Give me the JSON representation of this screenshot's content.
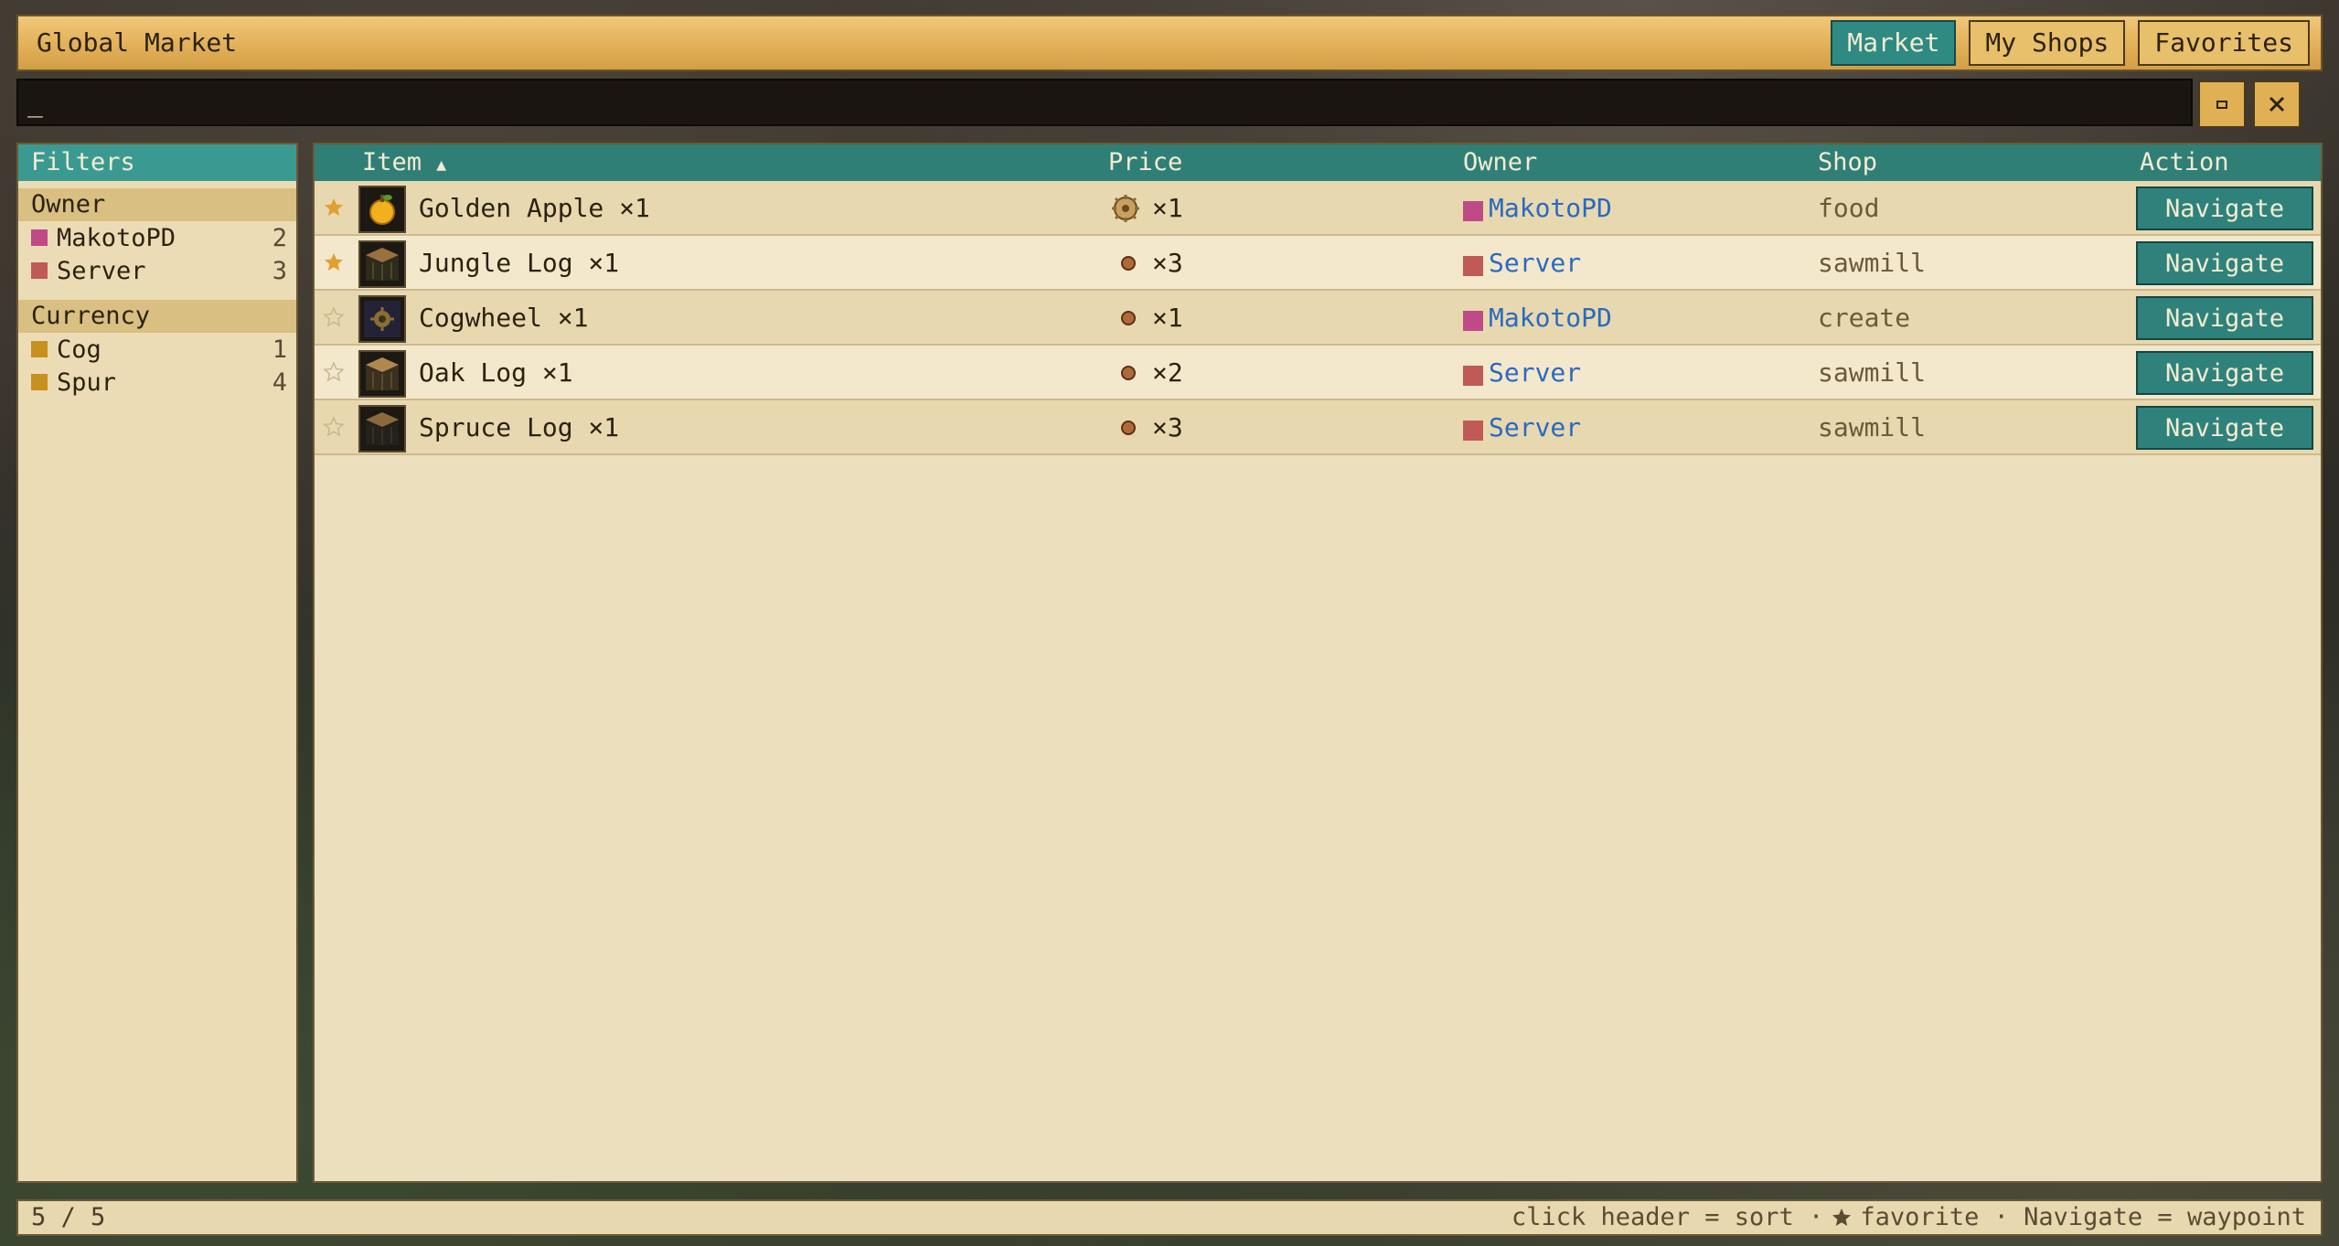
{
  "window": {
    "title": "Global Market"
  },
  "tabs": [
    {
      "label": "Market",
      "active": true
    },
    {
      "label": "My Shops",
      "active": false
    },
    {
      "label": "Favorites",
      "active": false
    }
  ],
  "search": {
    "value": "_",
    "refresh_icon": "refresh-icon",
    "close_icon": "close-icon"
  },
  "filters": {
    "title": "Filters",
    "groups": [
      {
        "label": "Owner",
        "items": [
          {
            "label": "MakotoPD",
            "count": "2",
            "color": "#c04a86"
          },
          {
            "label": "Server",
            "count": "3",
            "color": "#c05a56"
          }
        ]
      },
      {
        "label": "Currency",
        "items": [
          {
            "label": "Cog",
            "count": "1",
            "color": "#c8901e"
          },
          {
            "label": "Spur",
            "count": "4",
            "color": "#c8901e"
          }
        ]
      }
    ]
  },
  "table": {
    "headers": {
      "item": "Item",
      "sort_indicator": "▲",
      "price": "Price",
      "owner": "Owner",
      "shop": "Shop",
      "action": "Action"
    },
    "rows": [
      {
        "favorite": true,
        "icon": "golden-apple-icon",
        "item": "Golden Apple ×1",
        "price_icon": "cog-coin-icon",
        "price": "×1",
        "owner": "MakotoPD",
        "owner_color": "#c04a86",
        "shop": "food",
        "action": "Navigate"
      },
      {
        "favorite": true,
        "icon": "jungle-log-icon",
        "item": "Jungle Log ×1",
        "price_icon": "spur-coin-icon",
        "price": "×3",
        "owner": "Server",
        "owner_color": "#c05a56",
        "shop": "sawmill",
        "action": "Navigate"
      },
      {
        "favorite": false,
        "icon": "cogwheel-icon",
        "item": "Cogwheel ×1",
        "price_icon": "spur-coin-icon",
        "price": "×1",
        "owner": "MakotoPD",
        "owner_color": "#c04a86",
        "shop": "create",
        "action": "Navigate"
      },
      {
        "favorite": false,
        "icon": "oak-log-icon",
        "item": "Oak Log ×1",
        "price_icon": "spur-coin-icon",
        "price": "×2",
        "owner": "Server",
        "owner_color": "#c05a56",
        "shop": "sawmill",
        "action": "Navigate"
      },
      {
        "favorite": false,
        "icon": "spruce-log-icon",
        "item": "Spruce Log ×1",
        "price_icon": "spur-coin-icon",
        "price": "×3",
        "owner": "Server",
        "owner_color": "#c05a56",
        "shop": "sawmill",
        "action": "Navigate"
      }
    ]
  },
  "status": {
    "count": "5 / 5",
    "hint_sort": "click header = sort ·",
    "hint_favorite": "favorite · Navigate = waypoint"
  },
  "colors": {
    "accent": "#2f827b",
    "favorite": "#e0a030",
    "link": "#2a6ac0"
  }
}
